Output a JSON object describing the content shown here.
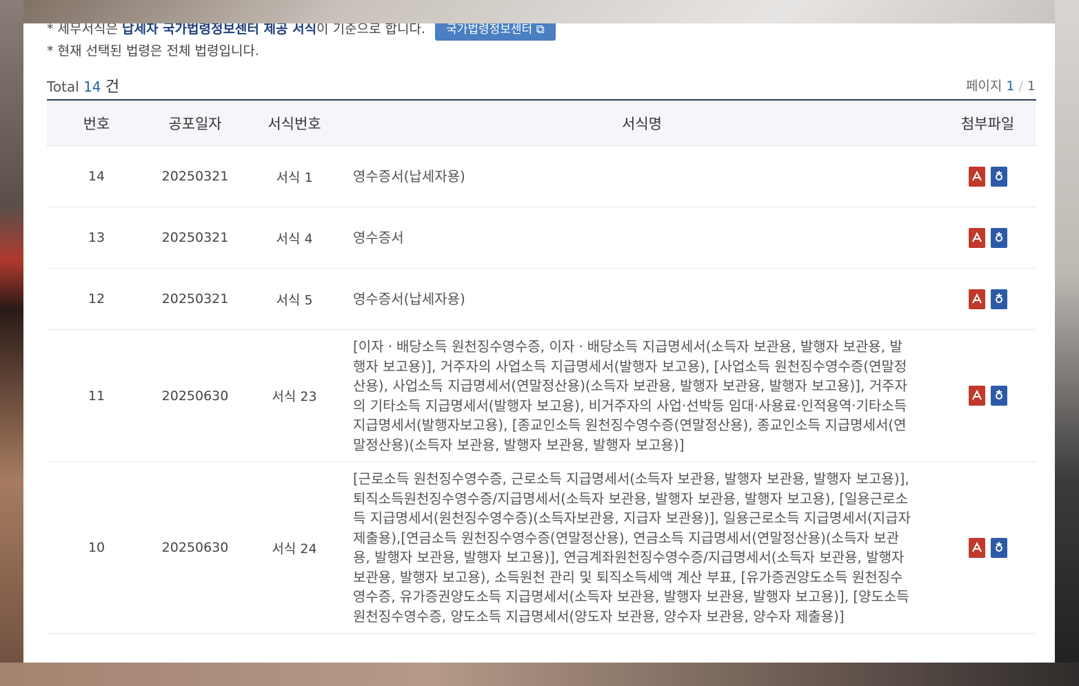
{
  "notice": {
    "line1_prefix": "* 세무서식은",
    "line1_link": "납세자 국가법령정보센터 제공 서식",
    "line1_suffix": "이 기준으로 합니다.",
    "button_label": "국가법령정보센터",
    "line2": "* 현재 선택된 법령은 전체 법령입니다."
  },
  "summary": {
    "total_label": "Total",
    "total_count": "14",
    "total_unit": "건",
    "page_label": "페이지",
    "page_current": "1",
    "page_total": "1"
  },
  "table": {
    "headers": [
      "번호",
      "공포일자",
      "서식번호",
      "서식명",
      "첨부파일"
    ],
    "rows": [
      {
        "no": "14",
        "date": "20250321",
        "form": "서식 1",
        "title": "영수증서(납세자용)"
      },
      {
        "no": "13",
        "date": "20250321",
        "form": "서식 4",
        "title": "영수증서"
      },
      {
        "no": "12",
        "date": "20250321",
        "form": "서식 5",
        "title": "영수증서(납세자용)"
      },
      {
        "no": "11",
        "date": "20250630",
        "form": "서식 23",
        "title": "[이자ㆍ배당소득 원천징수영수증, 이자ㆍ배당소득 지급명세서(소득자 보관용, 발행자 보관용, 발행자 보고용)], 거주자의 사업소득 지급명세서(발행자 보고용), [사업소득 원천징수영수증(연말정산용), 사업소득 지급명세서(연말정산용)(소득자 보관용, 발행자 보관용, 발행자 보고용)], 거주자의 기타소득 지급명세서(발행자 보고용), 비거주자의 사업·선박등 임대·사용료·인적용역·기타소득 지급명세서(발행자보고용), [종교인소득 원천징수영수증(연말정산용), 종교인소득 지급명세서(연말정산용)(소득자 보관용, 발행자 보관용, 발행자 보고용)]"
      },
      {
        "no": "10",
        "date": "20250630",
        "form": "서식 24",
        "title": "[근로소득 원천징수영수증, 근로소득 지급명세서(소득자 보관용, 발행자 보관용, 발행자 보고용)], 퇴직소득원천징수영수증/지급명세서(소득자 보관용, 발행자 보관용, 발행자 보고용), [일용근로소득 지급명세서(원천징수영수증)(소득자보관용, 지급자 보관용)], 일용근로소득 지급명세서(지급자제출용),[연금소득 원천징수영수증(연말정산용), 연금소득 지급명세서(연말정산용)(소득자 보관용, 발행자 보관용, 발행자 보고용)], 연금계좌원천징수영수증/지급명세서(소득자 보관용, 발행자 보관용, 발행자 보고용), 소득원천 관리 및 퇴직소득세액 계산 부표, [유가증권양도소득 원천징수영수증, 유가증권양도소득 지급명세서(소득자 보관용, 발행자 보관용, 발행자 보고용)], [양도소득 원천징수영수증, 양도소득 지급명세서(양도자 보관용, 양수자 보관용, 양수자 제출용)]"
      }
    ]
  },
  "icons": {
    "pdf": "pdf-file-icon",
    "hwp": "hwp-file-icon"
  },
  "colors": {
    "accent": "#1f5fa8",
    "pdf": "#c0392b",
    "hwp": "#2d5aa8",
    "header_border": "#2c3a4f"
  }
}
